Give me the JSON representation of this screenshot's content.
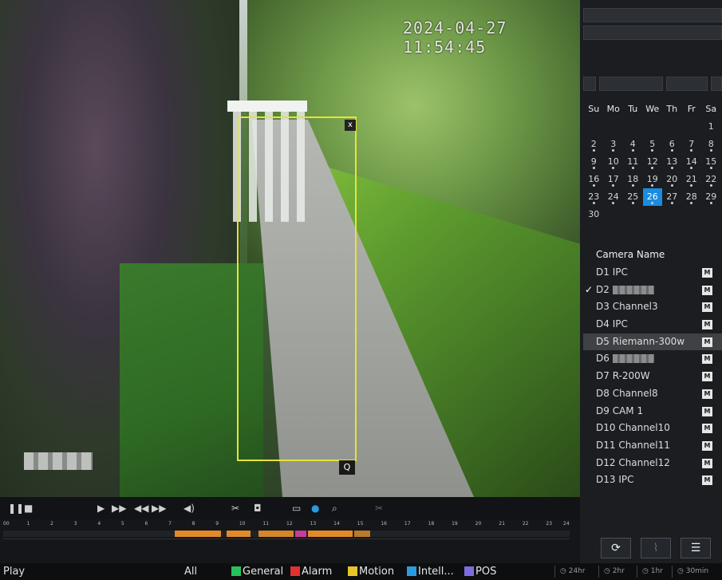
{
  "video": {
    "timestamp": "2024-04-27 11:54:45",
    "close_glyph": "x",
    "zoom_glyph": "Q"
  },
  "calendar": {
    "weekdays": [
      "Su",
      "Mo",
      "Tu",
      "We",
      "Th",
      "Fr",
      "Sa"
    ],
    "weeks": [
      [
        "",
        "",
        "",
        "",
        "",
        "",
        "1"
      ],
      [
        "2",
        "3",
        "4",
        "5",
        "6",
        "7",
        "8"
      ],
      [
        "9",
        "10",
        "11",
        "12",
        "13",
        "14",
        "15"
      ],
      [
        "16",
        "17",
        "18",
        "19",
        "20",
        "21",
        "22"
      ],
      [
        "23",
        "24",
        "25",
        "26",
        "27",
        "28",
        "29"
      ],
      [
        "30",
        "",
        "",
        "",
        "",
        "",
        ""
      ]
    ],
    "selected_day": "26"
  },
  "camera_list": {
    "header": "Camera Name",
    "items": [
      {
        "label": "D1 IPC",
        "checked": false,
        "blurred": false
      },
      {
        "label": "D2",
        "checked": true,
        "blurred": true
      },
      {
        "label": "D3 Channel3",
        "checked": false,
        "blurred": false
      },
      {
        "label": "D4 IPC",
        "checked": false,
        "blurred": false
      },
      {
        "label": "D5 Riemann-300w",
        "checked": false,
        "blurred": false,
        "highlight": true
      },
      {
        "label": "D6",
        "checked": false,
        "blurred": true
      },
      {
        "label": "D7 R-200W",
        "checked": false,
        "blurred": false
      },
      {
        "label": "D8 Channel8",
        "checked": false,
        "blurred": false
      },
      {
        "label": "D9 CAM 1",
        "checked": false,
        "blurred": false
      },
      {
        "label": "D10 Channel10",
        "checked": false,
        "blurred": false
      },
      {
        "label": "D11 Channel11",
        "checked": false,
        "blurred": false
      },
      {
        "label": "D12 Channel12",
        "checked": false,
        "blurred": false
      },
      {
        "label": "D13 IPC",
        "checked": false,
        "blurred": false
      }
    ],
    "m_label": "M"
  },
  "timeline": {
    "hours": [
      "00",
      "1",
      "2",
      "3",
      "4",
      "5",
      "6",
      "7",
      "8",
      "9",
      "10",
      "11",
      "12",
      "13",
      "14",
      "15",
      "16",
      "17",
      "18",
      "19",
      "20",
      "21",
      "22",
      "23",
      "24"
    ]
  },
  "bottom_bar": {
    "mode": "Play",
    "filter_all": "All",
    "legend": [
      {
        "label": "General",
        "color": "#27c15a"
      },
      {
        "label": "Alarm",
        "color": "#e0322f"
      },
      {
        "label": "Motion",
        "color": "#e8c32a"
      },
      {
        "label": "Intell...",
        "color": "#2b9be0"
      },
      {
        "label": "POS",
        "color": "#7b6de0"
      }
    ],
    "zoom_options": [
      "24hr",
      "2hr",
      "1hr",
      "30min"
    ]
  }
}
